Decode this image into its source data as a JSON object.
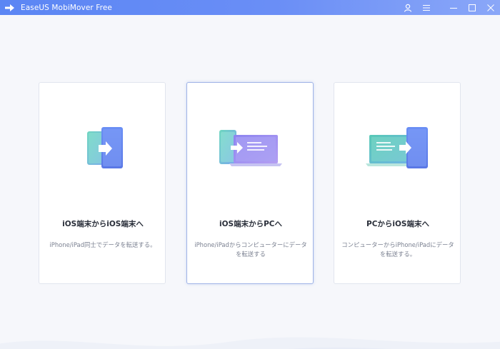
{
  "window": {
    "title": "EaseUS MobiMover Free",
    "icons": {
      "logo": "arrow-transfer-icon",
      "account": "user-icon",
      "menu": "menu-icon",
      "minimize": "minimize-icon",
      "maximize": "maximize-icon",
      "close": "close-icon"
    }
  },
  "colors": {
    "titlebar_start": "#5b86f4",
    "titlebar_end": "#8aa7f8",
    "background": "#f6f7fb",
    "card_border": "#e1e5ee",
    "selected_border": "#9fb3e6",
    "title_text": "#2a2f3a",
    "desc_text": "#7b8191"
  },
  "cards": [
    {
      "title": "iOS端末からiOS端末へ",
      "description": "iPhone/iPad同士でデータを転送する。",
      "icon": "phone-to-phone-icon",
      "selected": false
    },
    {
      "title": "iOS端末からPCへ",
      "description": "iPhone/iPadからコンピューターにデータを転送する",
      "icon": "phone-to-laptop-icon",
      "selected": true
    },
    {
      "title": "PCからiOS端末へ",
      "description": "コンピューターからiPhone/iPadにデータを転送する。",
      "icon": "laptop-to-phone-icon",
      "selected": false
    }
  ]
}
